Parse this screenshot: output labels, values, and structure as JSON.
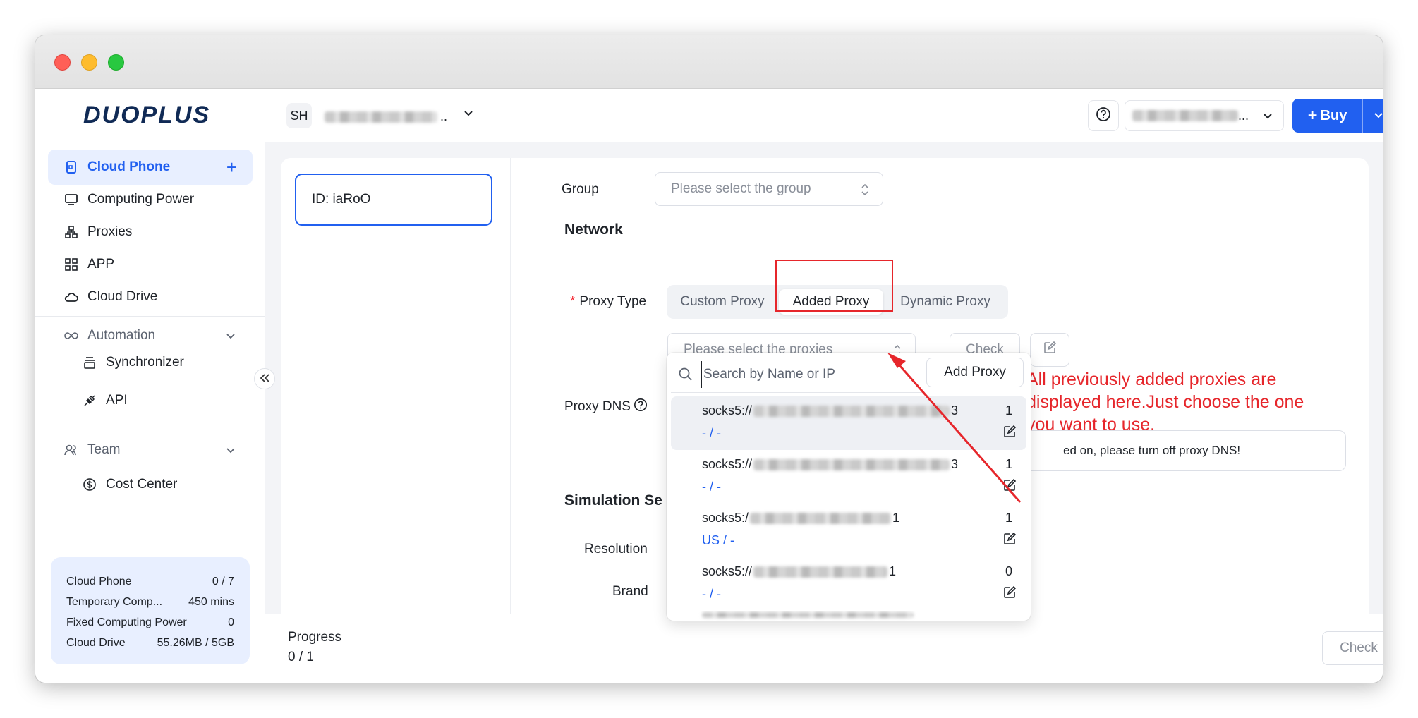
{
  "sidebar": {
    "logo": "DUOPLUS",
    "items": [
      {
        "label": "Cloud Phone"
      },
      {
        "label": "Computing Power"
      },
      {
        "label": "Proxies"
      },
      {
        "label": "APP"
      },
      {
        "label": "Cloud Drive"
      }
    ],
    "automation": {
      "label": "Automation",
      "children": [
        {
          "label": "Synchronizer"
        },
        {
          "label": "API"
        }
      ]
    },
    "team": {
      "label": "Team",
      "children": [
        {
          "label": "Cost Center"
        }
      ]
    },
    "usage": [
      {
        "label": "Cloud Phone",
        "value": "0 / 7"
      },
      {
        "label": "Temporary Comp...",
        "value": "450 mins"
      },
      {
        "label": "Fixed Computing Power",
        "value": "0"
      },
      {
        "label": "Cloud Drive",
        "value": "55.26MB / 5GB"
      }
    ]
  },
  "topbar": {
    "workspace_badge": "SH",
    "workspace_suffix": "..",
    "account_suffix": "...",
    "buy_label": "Buy"
  },
  "device": {
    "id_label": "ID: iaRoO"
  },
  "form": {
    "group_label": "Group",
    "group_placeholder": "Please select the group",
    "network_title": "Network",
    "proxy_type_label": "Proxy Type",
    "proxy_types": [
      "Custom Proxy",
      "Added Proxy",
      "Dynamic Proxy"
    ],
    "proxy_placeholder": "Please select the proxies",
    "check_label": "Check",
    "proxy_dns_label": "Proxy DNS",
    "dns_alert": "ed on, please turn off proxy DNS!",
    "simulation_title": "Simulation Se",
    "resolution_label": "Resolution",
    "brand_label_partial": "Brand"
  },
  "dropdown": {
    "search_placeholder": "Search by Name or IP",
    "add_proxy_label": "Add Proxy",
    "options": [
      {
        "prefix": "socks5://",
        "suffix": "3",
        "count": "1",
        "location": "- / -"
      },
      {
        "prefix": "socks5://",
        "suffix": "3",
        "count": "1",
        "location": "- / -"
      },
      {
        "prefix": "socks5:/",
        "suffix": "1",
        "count": "1",
        "location": "US / -"
      },
      {
        "prefix": "socks5://",
        "suffix": "1",
        "count": "0",
        "location": "- / -"
      }
    ]
  },
  "annotation": {
    "text": "All previously added proxies are displayed here.Just choose the one you want to use."
  },
  "bottom": {
    "progress_label": "Progress",
    "progress_value": "0 / 1",
    "check_label": "Check"
  },
  "colors": {
    "accent": "#2160f0",
    "annotation_red": "#e6262b"
  }
}
